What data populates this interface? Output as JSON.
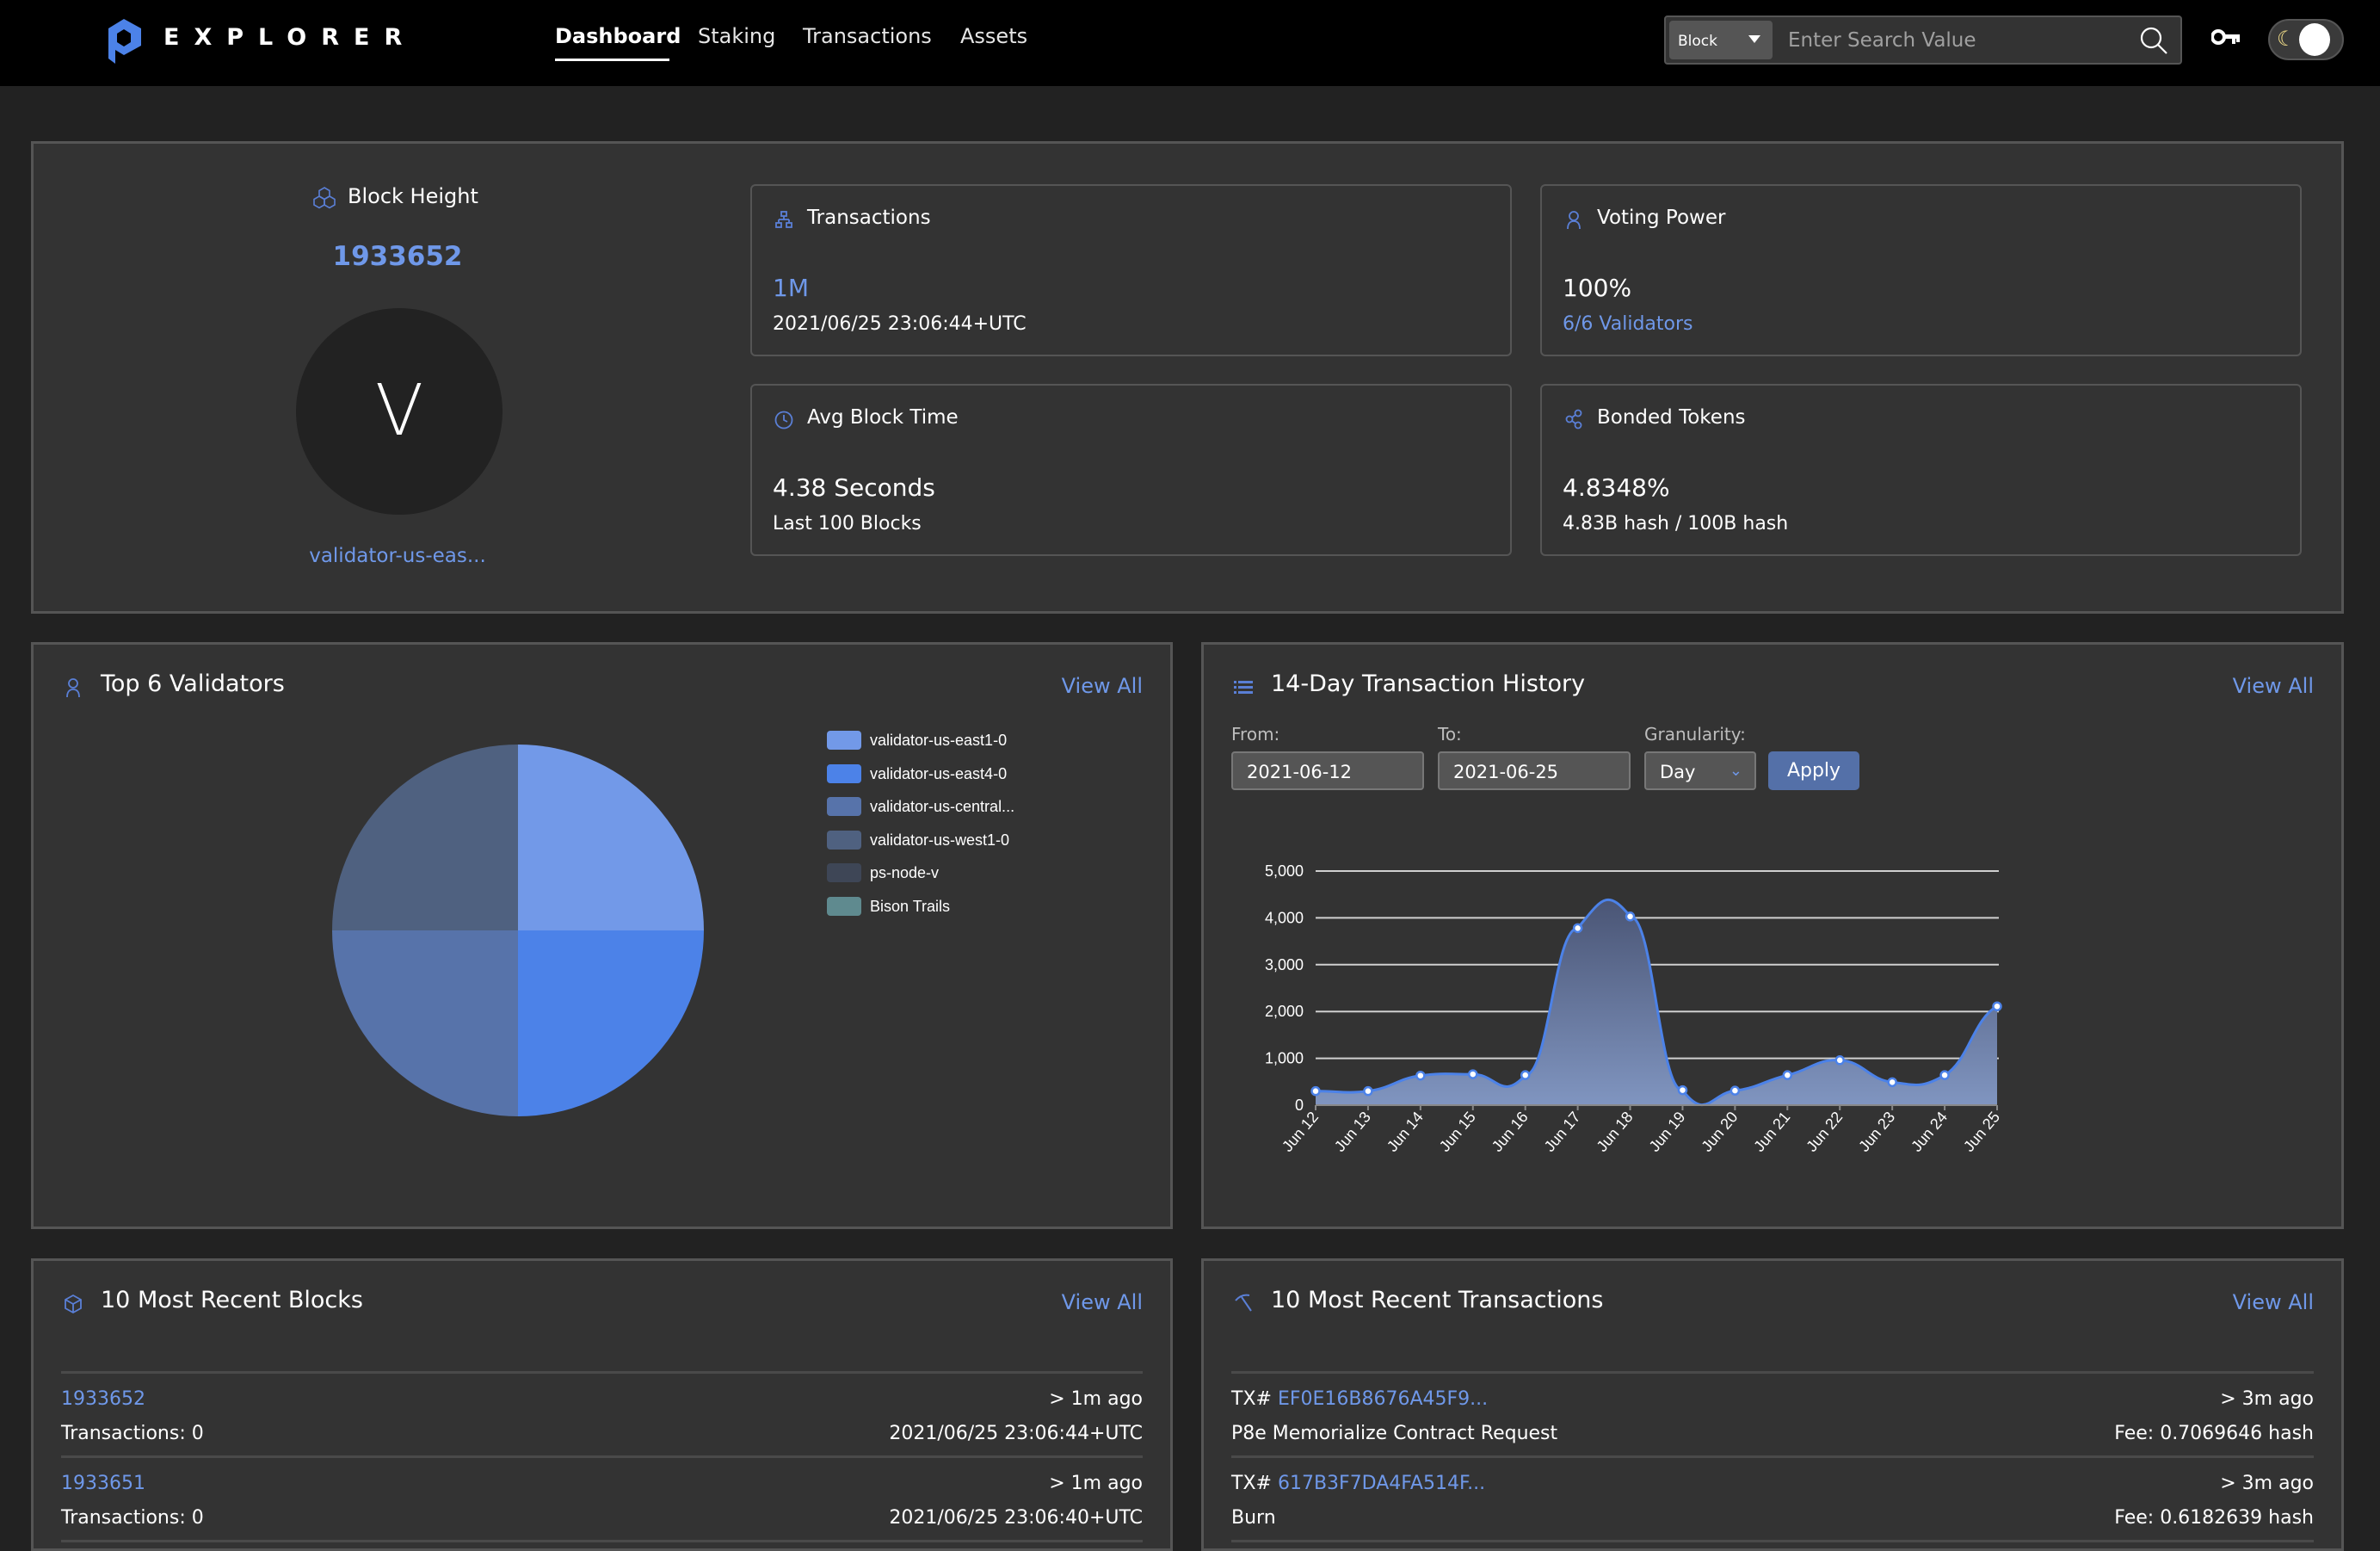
{
  "header": {
    "brand": "EXPLORER",
    "nav": [
      {
        "label": "Dashboard",
        "active": true
      },
      {
        "label": "Staking",
        "active": false
      },
      {
        "label": "Transactions",
        "active": false
      },
      {
        "label": "Assets",
        "active": false
      }
    ],
    "search": {
      "type_selected": "Block",
      "placeholder": "Enter Search Value",
      "value": ""
    },
    "icons": {
      "key": "key-icon",
      "theme_toggle": "moon-sun-toggle"
    }
  },
  "overview": {
    "block_height": {
      "label": "Block Height",
      "value": "1933652",
      "avatar_letter": "V",
      "validator": "validator-us-eas..."
    },
    "stats": [
      {
        "title": "Transactions",
        "icon": "network-icon",
        "value": "1M",
        "value_color": "#6f98e9",
        "sub": "2021/06/25 23:06:44+UTC",
        "sub_link": false
      },
      {
        "title": "Voting Power",
        "icon": "user-icon",
        "value": "100%",
        "sub": "6/6 Validators",
        "sub_link": true
      },
      {
        "title": "Avg Block Time",
        "icon": "clock-icon",
        "value": "4.38 Seconds",
        "sub": "Last 100 Blocks",
        "sub_link": false
      },
      {
        "title": "Bonded Tokens",
        "icon": "share-icon",
        "value": "4.8348%",
        "sub": "4.83B hash / 100B hash",
        "sub_link": false
      }
    ]
  },
  "validators_panel": {
    "title": "Top 6 Validators",
    "view_all": "View All"
  },
  "history_panel": {
    "title": "14-Day Transaction History",
    "view_all": "View All",
    "from_label": "From:",
    "from_value": "2021-06-12",
    "to_label": "To:",
    "to_value": "2021-06-25",
    "granularity_label": "Granularity:",
    "granularity_value": "Day",
    "apply_label": "Apply"
  },
  "chart_data": [
    {
      "type": "pie",
      "title": "Top 6 Validators",
      "categories": [
        "validator-us-east1-0",
        "validator-us-east4-0",
        "validator-us-central...",
        "validator-us-west1-0",
        "ps-node-v",
        "Bison Trails"
      ],
      "values": [
        25,
        25,
        25,
        25,
        0,
        0
      ],
      "colors": [
        "#7299e8",
        "#4c82e8",
        "#5773aa",
        "#4f6180",
        "#3e4656",
        "#5f8a8f"
      ],
      "legend": "right"
    },
    {
      "type": "area",
      "title": "14-Day Transaction History",
      "x": [
        "Jun 12",
        "Jun 13",
        "Jun 14",
        "Jun 15",
        "Jun 16",
        "Jun 17",
        "Jun 18",
        "Jun 19",
        "Jun 20",
        "Jun 21",
        "Jun 22",
        "Jun 23",
        "Jun 24",
        "Jun 25"
      ],
      "values": [
        300,
        300,
        630,
        660,
        640,
        3780,
        4030,
        320,
        310,
        640,
        960,
        490,
        640,
        2110
      ],
      "ylim": [
        0,
        5000
      ],
      "yticks": [
        0,
        1000,
        2000,
        3000,
        4000,
        5000
      ],
      "ytick_labels": [
        "0",
        "1,000",
        "2,000",
        "3,000",
        "4,000",
        "5,000"
      ],
      "xlabel": "",
      "ylabel": "",
      "grid": true,
      "line_color": "#4c82e8"
    }
  ],
  "blocks_panel": {
    "title": "10 Most Recent Blocks",
    "view_all": "View All",
    "rows": [
      {
        "height": "1933652",
        "age": "> 1m ago",
        "txs": "Transactions: 0",
        "time": "2021/06/25 23:06:44+UTC"
      },
      {
        "height": "1933651",
        "age": "> 1m ago",
        "txs": "Transactions: 0",
        "time": "2021/06/25 23:06:40+UTC"
      }
    ]
  },
  "txs_panel": {
    "title": "10 Most Recent Transactions",
    "view_all": "View All",
    "rows": [
      {
        "prefix": "TX#",
        "hash": "EF0E16B8676A45F9...",
        "age": "> 3m ago",
        "type": "P8e Memorialize Contract Request",
        "fee": "Fee: 0.7069646 hash"
      },
      {
        "prefix": "TX#",
        "hash": "617B3F7DA4FA514F...",
        "age": "> 3m ago",
        "type": "Burn",
        "fee": "Fee: 0.6182639 hash"
      }
    ]
  }
}
